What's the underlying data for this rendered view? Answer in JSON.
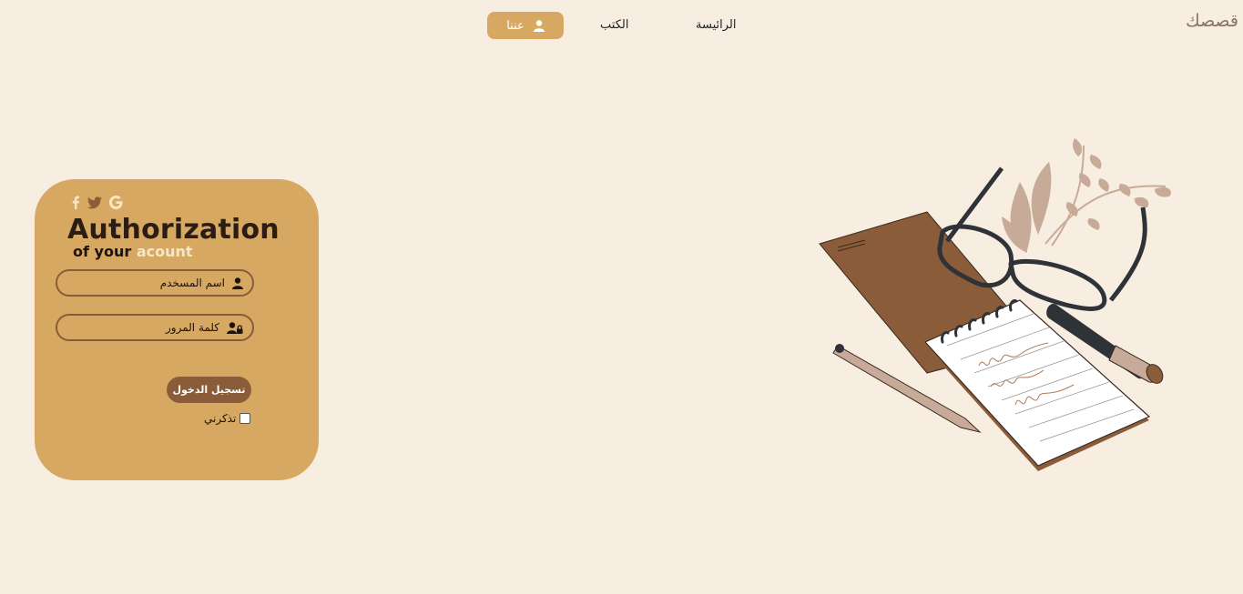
{
  "brand": {
    "name": "قصصك"
  },
  "nav": {
    "about": "عننا",
    "books": "الكتب",
    "home": "الرائيسة"
  },
  "login": {
    "social_icons": [
      "facebook-icon",
      "twitter-icon",
      "google-icon"
    ],
    "title": "Authorization",
    "subtitle_prefix": "of your",
    "subtitle_accent": "acount",
    "username_placeholder": "اسم المسخدم",
    "password_placeholder": "كلمة المرور",
    "submit_label": "تسجيل الدخول",
    "remember_label": "تذكرني",
    "remember_checked": false
  },
  "colors": {
    "background": "#f7ede0",
    "card": "#d6a861",
    "accent_brown": "#8b5c39",
    "accent_light": "#f7e6c8"
  }
}
